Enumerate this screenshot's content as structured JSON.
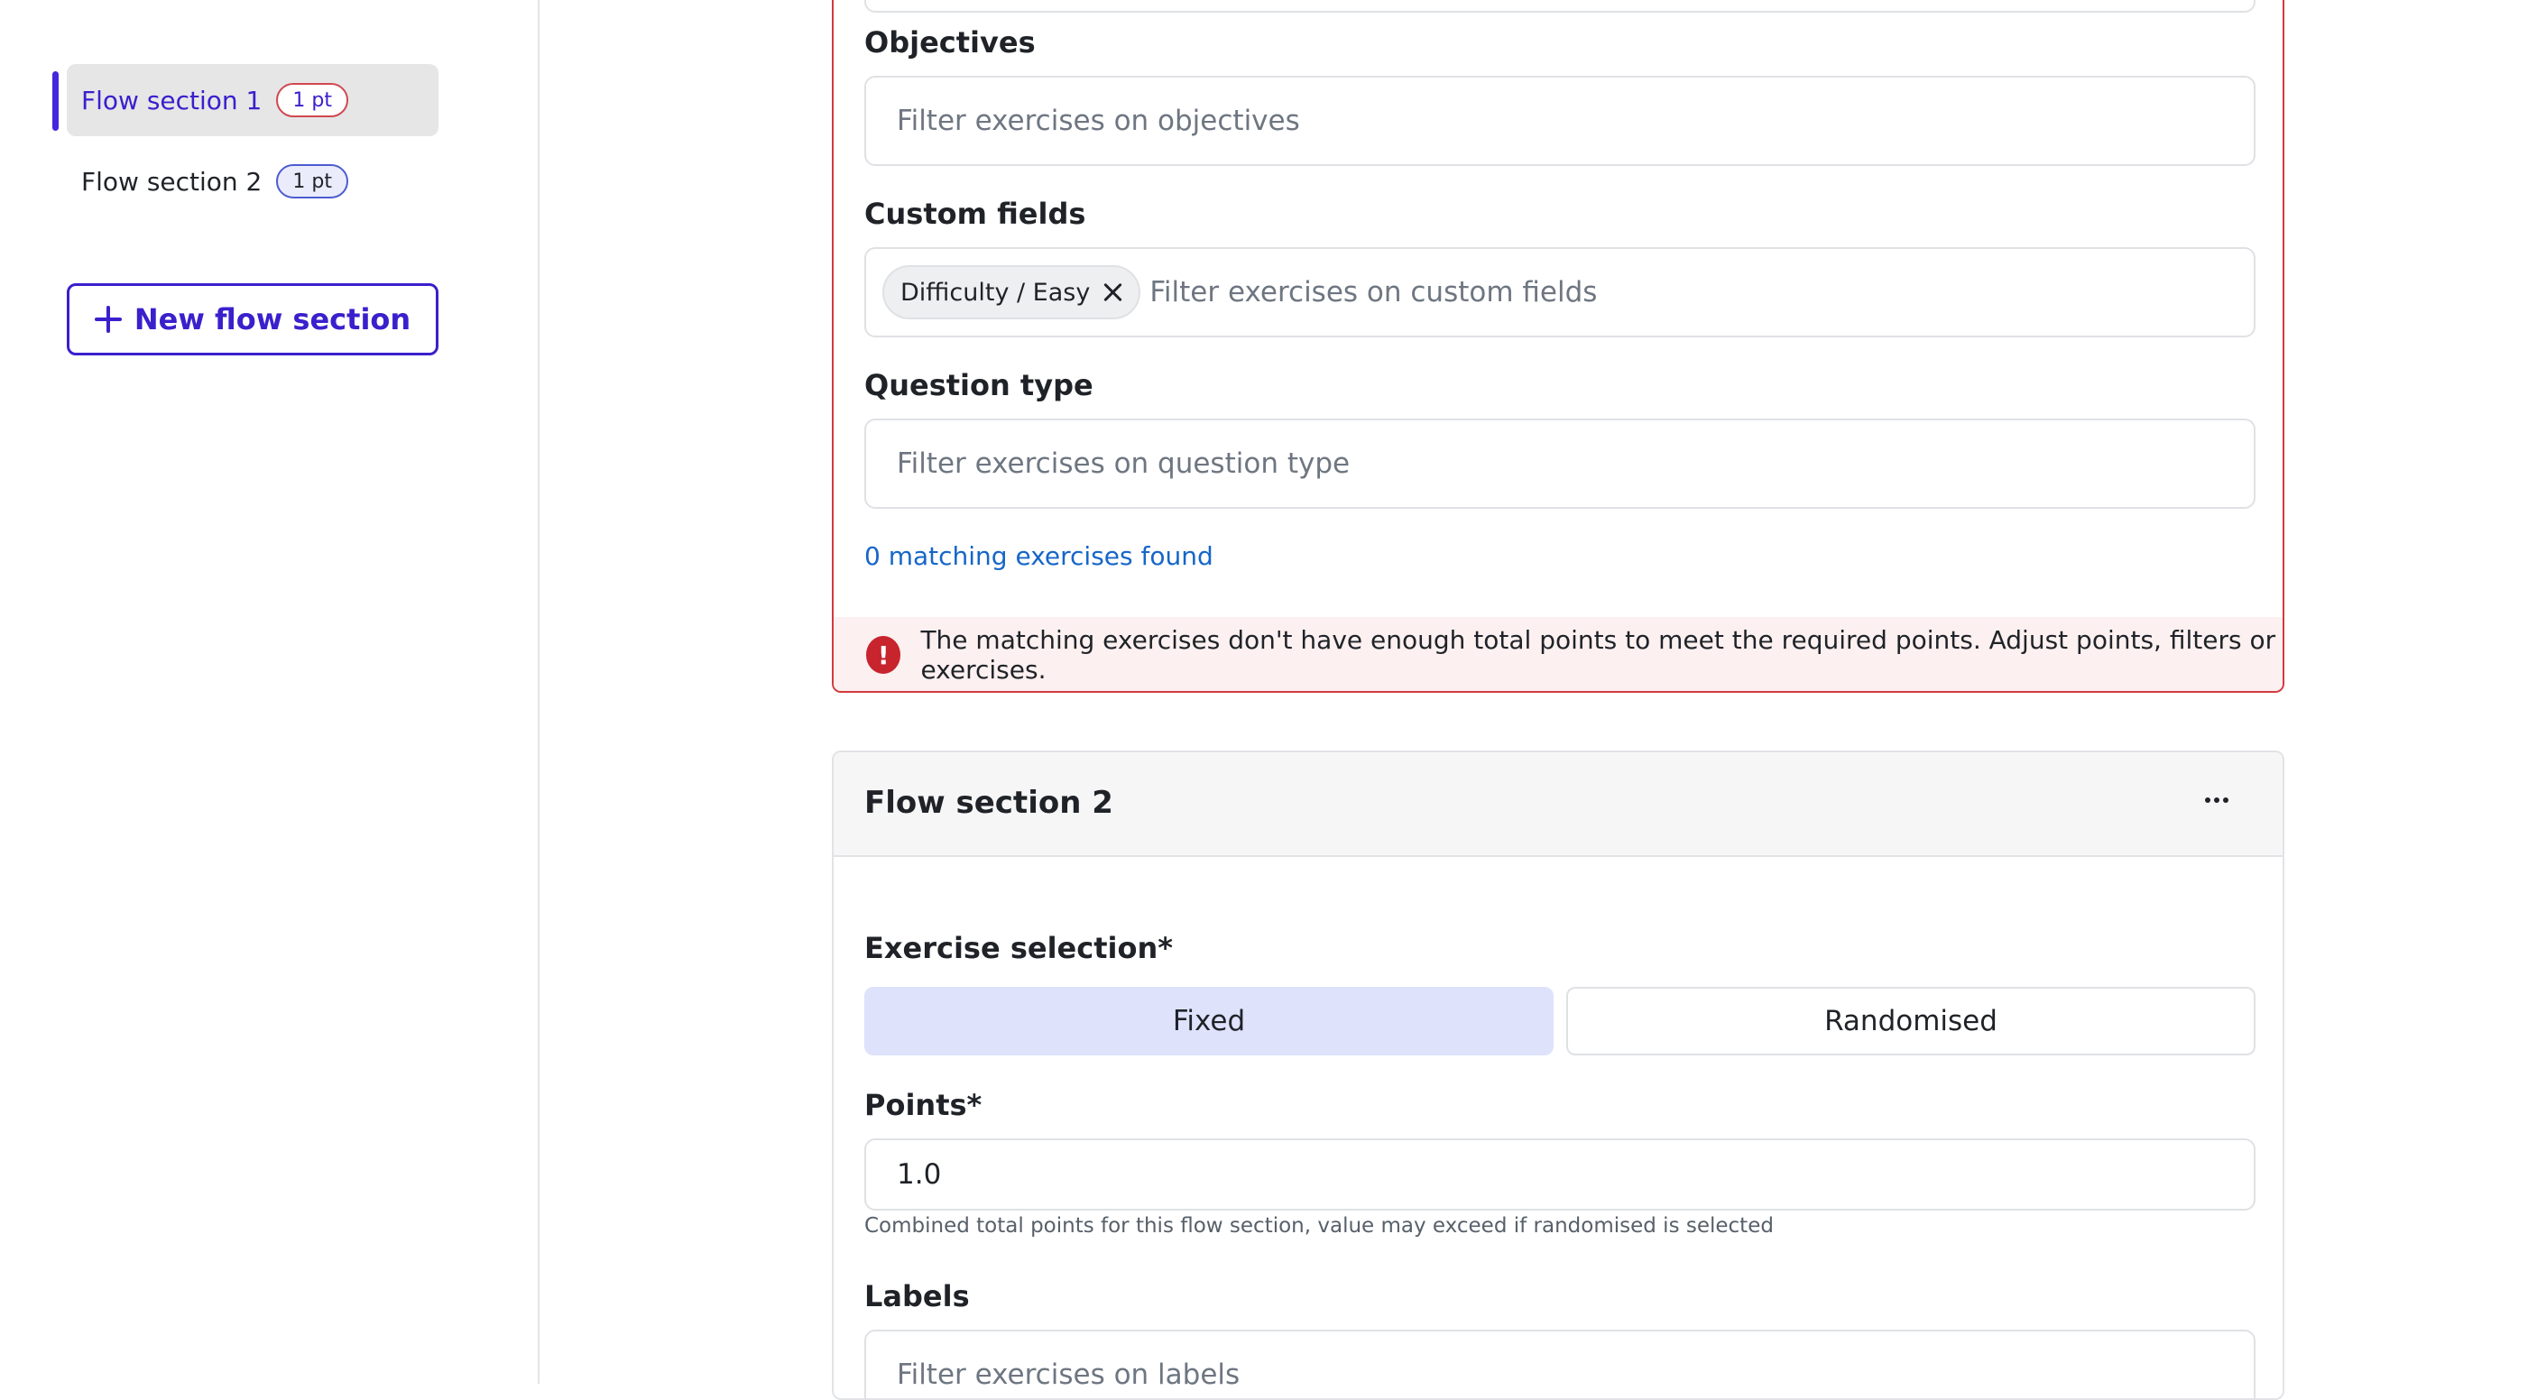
{
  "sidebar": {
    "items": [
      {
        "label": "Flow section 1",
        "badge": "1 pt",
        "active": true,
        "badge_status": "error"
      },
      {
        "label": "Flow section 2",
        "badge": "1 pt",
        "active": false,
        "badge_status": "ok"
      }
    ],
    "new_button_label": "New flow section"
  },
  "section1": {
    "objectives": {
      "label": "Objectives",
      "placeholder": "Filter exercises on objectives"
    },
    "custom_fields": {
      "label": "Custom fields",
      "chip": "Difficulty / Easy",
      "placeholder": "Filter exercises on custom fields"
    },
    "question_type": {
      "label": "Question type",
      "placeholder": "Filter exercises on question type"
    },
    "matching_link": "0 matching exercises found",
    "error_message": "The matching exercises don't have enough total points to meet the required points. Adjust points, filters or exercises.",
    "error_icon": "!"
  },
  "section2": {
    "title": "Flow section 2",
    "exercise_selection": {
      "label": "Exercise selection*",
      "options": [
        "Fixed",
        "Randomised"
      ],
      "selected": "Fixed"
    },
    "points": {
      "label": "Points*",
      "value": "1.0",
      "hint": "Combined total points for this flow section, value may exceed if randomised is selected"
    },
    "labels": {
      "label": "Labels",
      "placeholder": "Filter exercises on labels"
    }
  },
  "colors": {
    "accent": "#3a20cc",
    "error": "#d33a3f",
    "link": "#1666c8",
    "selected_segment": "#dfe2fb"
  }
}
